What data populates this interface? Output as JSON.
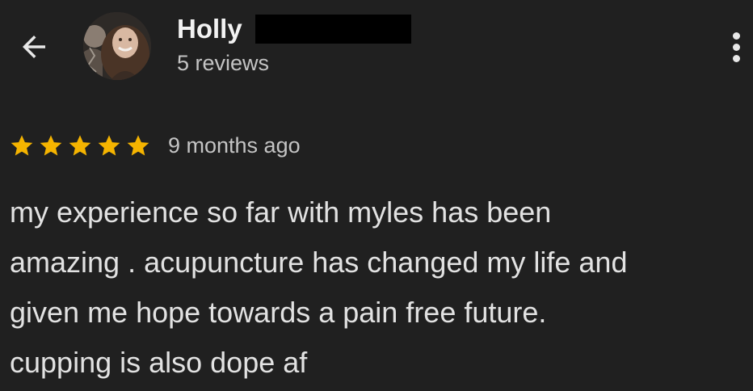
{
  "header": {
    "back_icon": "arrow-left-icon",
    "reviewer_name": "Holly",
    "review_count": "5 reviews",
    "more_icon": "more-vertical-icon"
  },
  "review": {
    "rating": 5,
    "rating_max": 5,
    "star_color": "#F5B400",
    "time_ago": "9 months ago",
    "text": "my experience so far with myles has been\namazing . acupuncture has changed my life and\ngiven me hope towards a pain free future.\ncupping is also dope af"
  },
  "colors": {
    "background": "#202020",
    "text_primary": "#E6E6E6",
    "text_secondary": "#C4C4C4"
  }
}
